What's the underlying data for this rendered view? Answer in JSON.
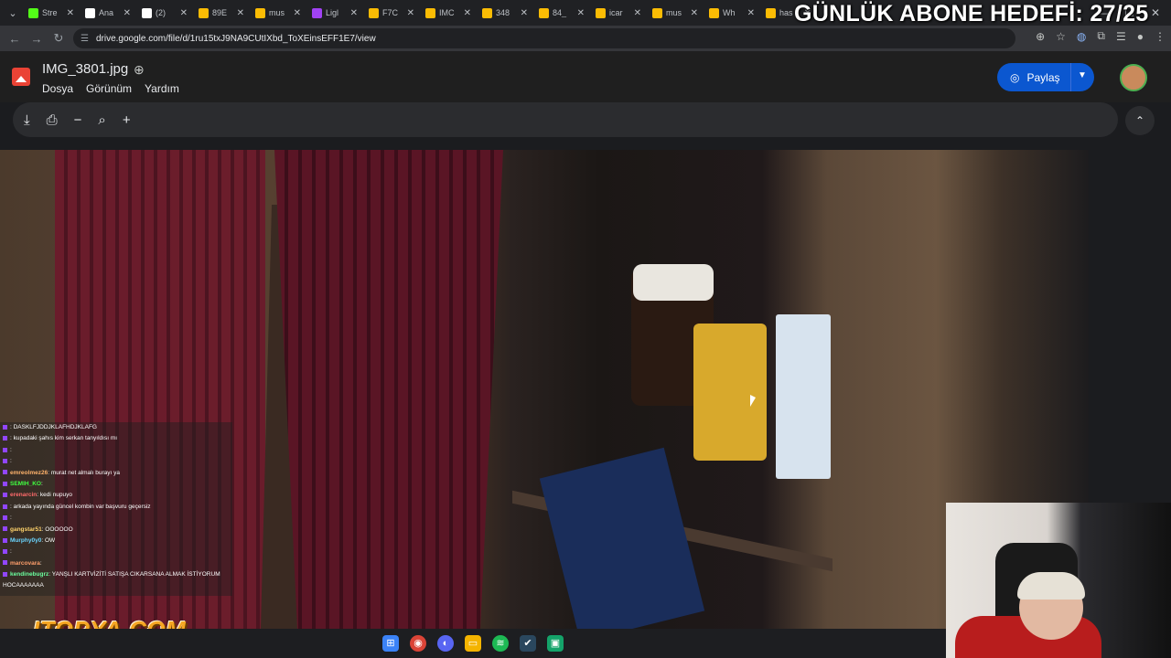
{
  "browser": {
    "tabs": [
      {
        "label": "Stre",
        "icon": "kick-icon",
        "color": "#53fc18"
      },
      {
        "label": "Ana",
        "icon": "x-icon",
        "color": "#ffffff"
      },
      {
        "label": "(2)",
        "icon": "x-icon",
        "color": "#ffffff"
      },
      {
        "label": "89E",
        "icon": "drive-icon",
        "color": "#fbbc04"
      },
      {
        "label": "mus",
        "icon": "drive-icon",
        "color": "#fbbc04"
      },
      {
        "label": "Ligl",
        "icon": "pen-icon",
        "color": "#a142f4"
      },
      {
        "label": "F7C",
        "icon": "drive-icon",
        "color": "#fbbc04"
      },
      {
        "label": "IMC",
        "icon": "drive-icon",
        "color": "#fbbc04"
      },
      {
        "label": "348",
        "icon": "drive-icon",
        "color": "#fbbc04"
      },
      {
        "label": "84_",
        "icon": "drive-icon",
        "color": "#fbbc04"
      },
      {
        "label": "icar",
        "icon": "drive-icon",
        "color": "#fbbc04"
      },
      {
        "label": "mus",
        "icon": "drive-icon",
        "color": "#fbbc04"
      },
      {
        "label": "Wh",
        "icon": "drive-icon",
        "color": "#fbbc04"
      },
      {
        "label": "has",
        "icon": "drive-icon",
        "color": "#fbbc04"
      }
    ],
    "url": "drive.google.com/file/d/1ru15txJ9NA9CUtIXbd_ToXEinsEFF1E7/view"
  },
  "drive": {
    "file_name": "IMG_3801.jpg",
    "menu": [
      "Dosya",
      "Görünüm",
      "Yardım"
    ],
    "share_label": "Paylaş"
  },
  "overlay": {
    "goal_text": "GÜNLÜK ABONE HEDEFİ: 27/25",
    "watermark": "ITOPYA.COM"
  },
  "chat": [
    {
      "user": "",
      "text": ": DASKLFJDDJKLAFHDJKLAFG",
      "color": "#ff7ce0"
    },
    {
      "user": "",
      "text": ": kupadaki şahıs kim serkan tanyıldısı mı",
      "color": "#7cc7ff"
    },
    {
      "user": "",
      "text": ":",
      "color": "#ff8f8f"
    },
    {
      "user": "",
      "text": ":",
      "color": "#7cffb0"
    },
    {
      "user": "emreolmez26",
      "text": ": murat net almalı burayı ya",
      "color": "#ffb36b"
    },
    {
      "user": "SEMIH_KO",
      "text": ": ",
      "color": "#40ff40"
    },
    {
      "user": "erenarcin",
      "text": ": kedi nupuyo",
      "color": "#ff6b6b"
    },
    {
      "user": "",
      "text": ": arkada yayında güncel kombin var başvuru geçersiz",
      "color": "#9f8fff"
    },
    {
      "user": "",
      "text": ":",
      "color": "#ff6bd6"
    },
    {
      "user": "gangstar51",
      "text": ": OOOOOO",
      "color": "#ffd36b"
    },
    {
      "user": "Murphy0y0",
      "text": ": OW",
      "color": "#6bd6ff"
    },
    {
      "user": "",
      "text": ":",
      "color": "#d06bff"
    },
    {
      "user": "marcovara",
      "text": ":",
      "color": "#ff9f6b"
    },
    {
      "user": "kendinebugrz",
      "text": ": YANŞLI KARTVİZİTİ SATIŞA CIKARSANA ALMAK İSTİYORUM",
      "color": "#6bff9f"
    },
    {
      "user": "",
      "text": "HOCAAAAAAA",
      "color": "#ffffff"
    }
  ]
}
